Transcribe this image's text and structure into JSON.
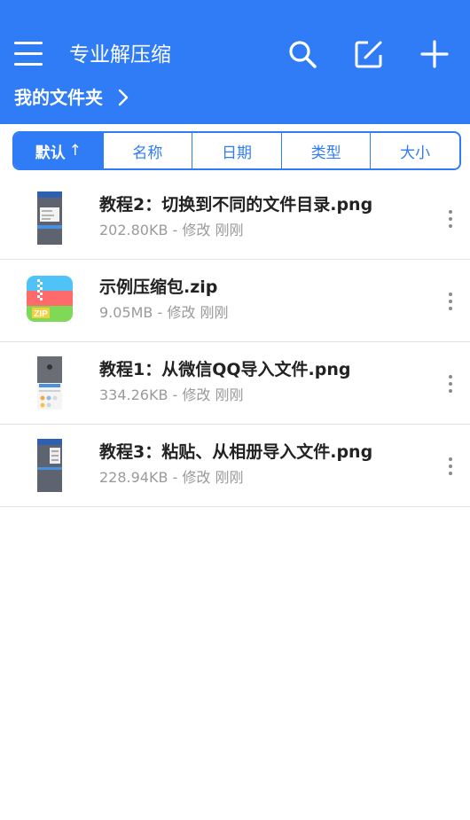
{
  "header": {
    "title": "专业解压缩",
    "breadcrumb": "我的文件夹",
    "colors": {
      "primary": "#2f7cf6"
    },
    "icons": [
      "menu-icon",
      "search-icon",
      "edit-icon",
      "add-icon",
      "chevron-right-icon"
    ]
  },
  "sort": {
    "tabs": [
      {
        "label": "默认",
        "active": true,
        "arrow": "↑"
      },
      {
        "label": "名称"
      },
      {
        "label": "日期"
      },
      {
        "label": "类型"
      },
      {
        "label": "大小"
      }
    ]
  },
  "files": [
    {
      "name": "教程2：切换到不同的文件目录.png",
      "meta": "202.80KB - 修改 刚刚",
      "type": "image"
    },
    {
      "name": "示例压缩包.zip",
      "meta": "9.05MB - 修改 刚刚",
      "type": "zip",
      "icon_text": "ZIP"
    },
    {
      "name": "教程1：从微信QQ导入文件.png",
      "meta": "334.26KB - 修改 刚刚",
      "type": "image"
    },
    {
      "name": "教程3：粘贴、从相册导入文件.png",
      "meta": "228.94KB - 修改 刚刚",
      "type": "image"
    }
  ]
}
